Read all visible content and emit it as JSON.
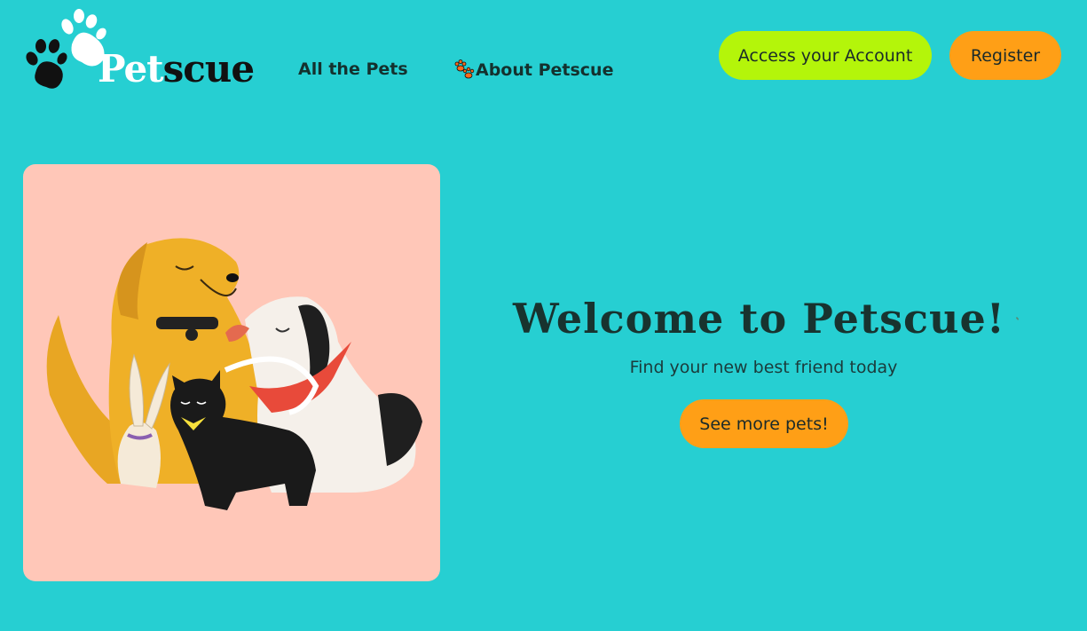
{
  "header": {
    "logo": {
      "prefix": "Pet",
      "suffix": "scue",
      "icon": "paw-icon"
    },
    "nav": [
      {
        "label": "All the Pets"
      },
      {
        "label": "About Petscue",
        "icon": "paw-icon"
      }
    ],
    "account_button": "Access your Account",
    "register_button": "Register"
  },
  "hero": {
    "image_alt": "illustration-dog-cat-rabbit",
    "title": "Welcome to Petscue!",
    "title_icon": "paw-icon",
    "subtitle": "Find your new best friend today",
    "cta": "See more pets!"
  },
  "colors": {
    "background": "#26cfd2",
    "accent_green": "#b4f50a",
    "accent_orange": "#ff9f16",
    "card_pink": "#ffc7b8",
    "text_dark": "#18332f"
  }
}
